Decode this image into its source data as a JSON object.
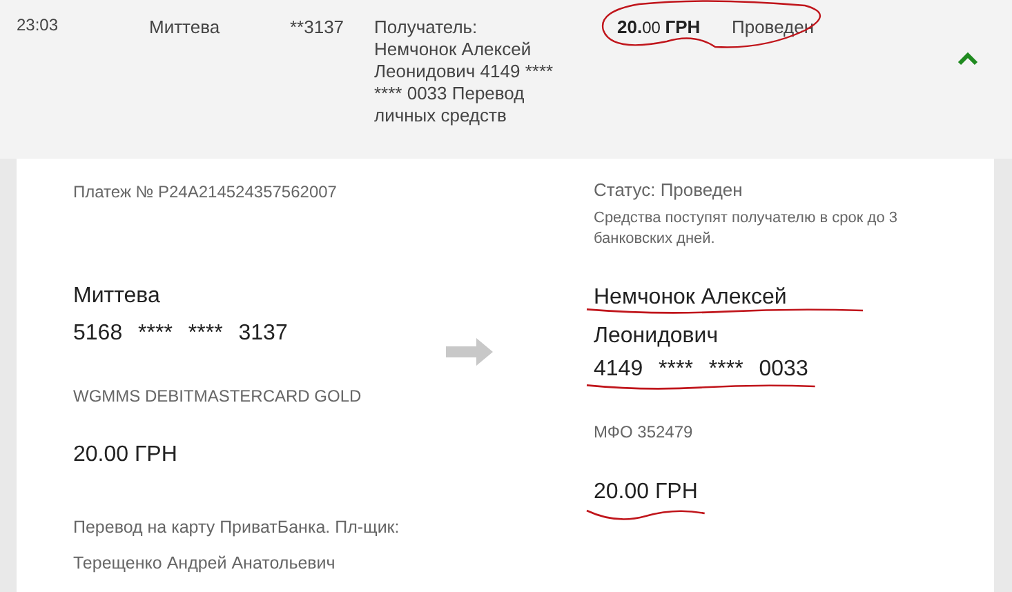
{
  "transaction": {
    "time": "23:03",
    "sender": "Миттева",
    "card": "**3137",
    "details": "Получатель: Немчонок Алексей Леонидович 4149 **** **** 0033 Перевод личных средств",
    "amount": "**20.**00 **ГРН**",
    "status": "Проведен",
    "circled": true,
    "expanded": true
  },
  "detail": {
    "payment_number": "Платеж № P24A214524357562007",
    "sender": {
      "name": "Миттева",
      "card": "5168 **** **** 3137",
      "card_type": "WGMMS DEBITMASTERCARD GOLD",
      "amount": "20.00 ГРН",
      "note": "Перевод на карту ПриватБанка. Пл-щик: Терещенко Андрей Анатольевич"
    },
    "status": "Статус: Проведен",
    "status_note": "Средства поступят получателю в срок до 3 банковских дней.",
    "recipient": {
      "name": "Немчонок Алексей Леонидович",
      "name_underlined": true,
      "card": "4149 **** **** 0033",
      "card_underlined": true,
      "mfo": "МФО 352479",
      "amount": "20.00 ГРН",
      "amount_underlined": true
    }
  }
}
